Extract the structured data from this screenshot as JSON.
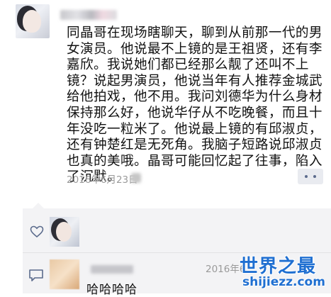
{
  "post": {
    "text": "同晶哥在现场瞎聊天，聊到从前那一代的男女演员。他说最不上镜的是王祖贤，还有李嘉欣。我说她们都已经那么靓了还叫不上镜？说起男演员，他说当年有人推荐金城武给他拍戏，他不用。我问刘德华为什么身材保持那么好，他说华仔从不吃晚餐，而且十年没吃一粒米了。他说最上镜的有邱淑贞，还有钟楚红是无死角。我脑子短路说邱淑贞也真的美哦。晶哥可能回忆起了往事，陷入了沉默。",
    "timestamp": "2016年6月23日"
  },
  "comment": {
    "timestamp": "2016年6",
    "text": "哈哈哈哈"
  },
  "watermark": {
    "title": "世界之最",
    "url": "shijiezz.com"
  },
  "colors": {
    "watermark": "#1f6fd1",
    "more_button_dots": "#5b6b8c",
    "interaction_bg": "#f3f3f5"
  },
  "icons": {
    "like": "heart-icon",
    "comment": "chat-bubble-icon",
    "more": "more-dots-icon"
  }
}
